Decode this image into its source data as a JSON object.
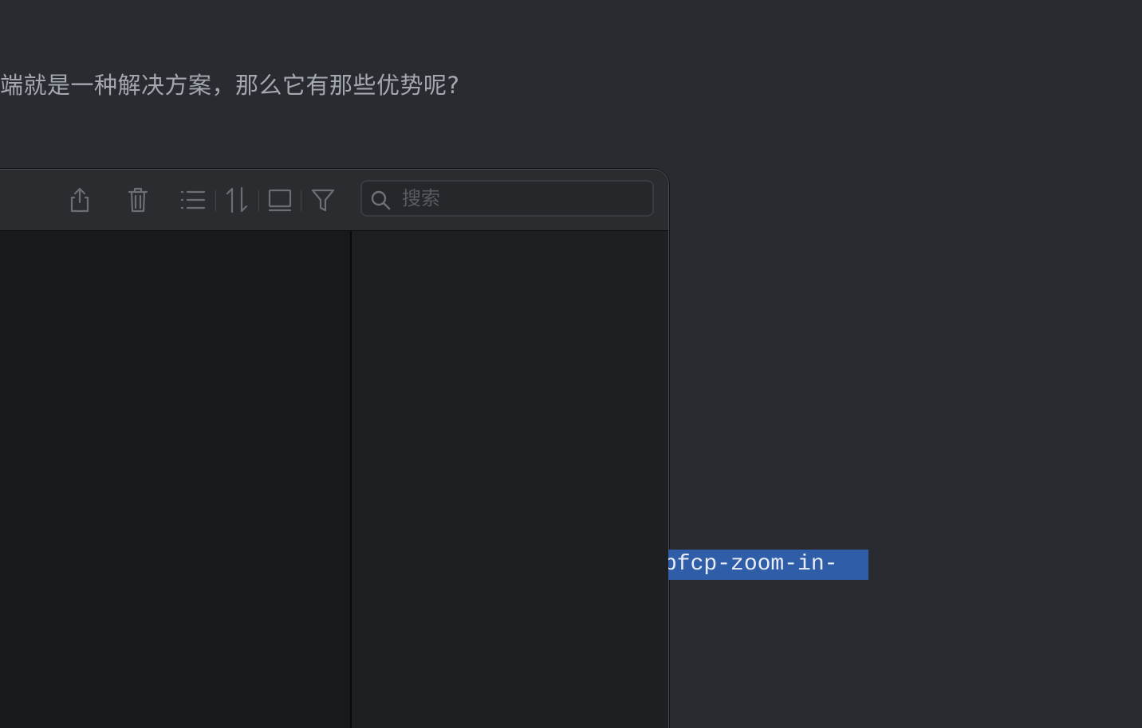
{
  "article": {
    "paragraph": "端就是一种解决方案，那么它有那些优势呢?"
  },
  "toolbar": {
    "buttons": [
      {
        "name": "share",
        "icon": "share-icon"
      },
      {
        "name": "trash",
        "icon": "trash-icon"
      },
      {
        "name": "list",
        "icon": "list-icon"
      },
      {
        "name": "sort",
        "icon": "sort-icon"
      },
      {
        "name": "panel",
        "icon": "panel-icon"
      },
      {
        "name": "filter",
        "icon": "filter-icon"
      }
    ],
    "search": {
      "placeholder": "搜索",
      "value": "",
      "icon": "search-icon"
    }
  },
  "code": {
    "selected_text": "pfcp-zoom-in-"
  },
  "colors": {
    "background": "#292b31",
    "selection": "#2f5da8",
    "icon": "#6b6e74"
  }
}
